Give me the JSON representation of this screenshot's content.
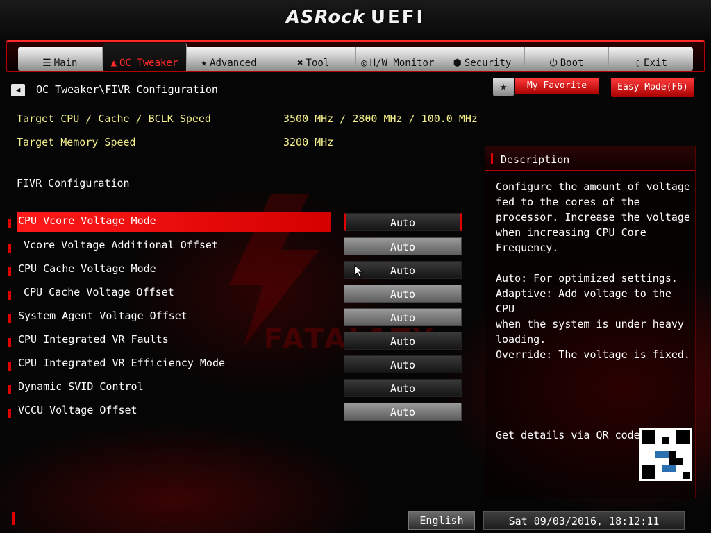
{
  "header": {
    "brand": "ASRock",
    "brand_sub": "UEFI"
  },
  "tabs": [
    {
      "label": "Main",
      "icon": "list-icon"
    },
    {
      "label": "OC Tweaker",
      "icon": "flame-icon"
    },
    {
      "label": "Advanced",
      "icon": "star-icon"
    },
    {
      "label": "Tool",
      "icon": "tools-icon"
    },
    {
      "label": "H/W Monitor",
      "icon": "monitor-icon"
    },
    {
      "label": "Security",
      "icon": "shield-icon"
    },
    {
      "label": "Boot",
      "icon": "power-icon"
    },
    {
      "label": "Exit",
      "icon": "exit-door-icon"
    }
  ],
  "active_tab": "OC Tweaker",
  "breadcrumb": "OC Tweaker\\FIVR Configuration",
  "buttons": {
    "my_favorite": "My Favorite",
    "easy_mode": "Easy Mode(F6)"
  },
  "info": {
    "cpu_label": "Target CPU / Cache / BCLK Speed",
    "cpu_value": "3500 MHz / 2800 MHz / 100.0 MHz",
    "mem_label": "Target Memory Speed",
    "mem_value": "3200 MHz"
  },
  "section_title": "FIVR Configuration",
  "settings": [
    {
      "label": "CPU Vcore Voltage Mode",
      "value": "Auto"
    },
    {
      "label": "Vcore Voltage Additional Offset",
      "value": "Auto"
    },
    {
      "label": "CPU Cache Voltage Mode",
      "value": "Auto"
    },
    {
      "label": "CPU Cache Voltage Offset",
      "value": "Auto"
    },
    {
      "label": "System Agent Voltage Offset",
      "value": "Auto"
    },
    {
      "label": "CPU Integrated VR Faults",
      "value": "Auto"
    },
    {
      "label": "CPU Integrated VR Efficiency Mode",
      "value": "Auto"
    },
    {
      "label": "Dynamic SVID Control",
      "value": "Auto"
    },
    {
      "label": "VCCU Voltage Offset",
      "value": "Auto"
    }
  ],
  "selected_setting": "CPU Vcore Voltage Mode",
  "description": {
    "title": "Description",
    "text": "Configure the amount of voltage\nfed to the cores of the\nprocessor. Increase the voltage\nwhen increasing CPU Core\nFrequency.\n\nAuto: For optimized settings.\nAdaptive: Add voltage to the CPU\nwhen the system is under heavy\nloading.\nOverride: The voltage is fixed.",
    "qr_label": "Get details via QR code"
  },
  "footer": {
    "language": "English",
    "datetime": "Sat 09/03/2016, 18:12:11"
  },
  "colors": {
    "accent": "#e00000",
    "info_text": "#f5f08a",
    "panel_border": "#5a0000"
  }
}
